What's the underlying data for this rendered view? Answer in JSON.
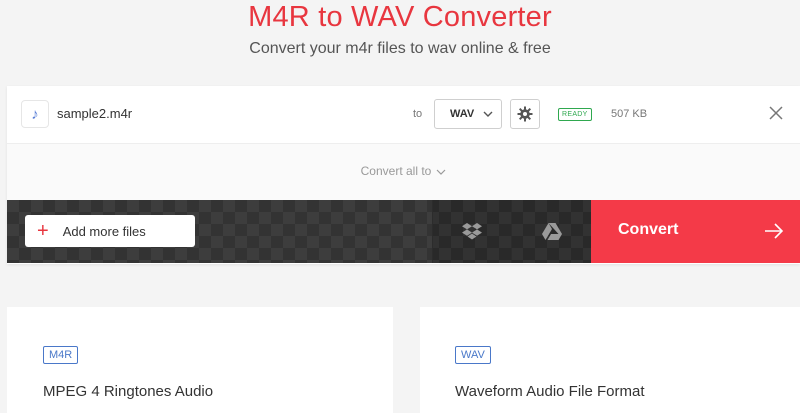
{
  "header": {
    "title": "M4R to WAV Converter",
    "subtitle": "Convert your m4r files to wav online & free"
  },
  "file": {
    "icon": "music-note-icon",
    "name": "sample2.m4r",
    "to_label": "to",
    "format": "WAV",
    "status": "READY",
    "size": "507 KB"
  },
  "convert_all_label": "Convert all to",
  "toolbar": {
    "add_files_label": "Add more files",
    "convert_label": "Convert"
  },
  "formats": [
    {
      "badge": "M4R",
      "description": "MPEG 4 Ringtones Audio"
    },
    {
      "badge": "WAV",
      "description": "Waveform Audio File Format"
    }
  ],
  "colors": {
    "accent": "#e8363f",
    "convert": "#f43a48",
    "ready": "#2fa84f",
    "format_badge": "#4a78c9"
  }
}
